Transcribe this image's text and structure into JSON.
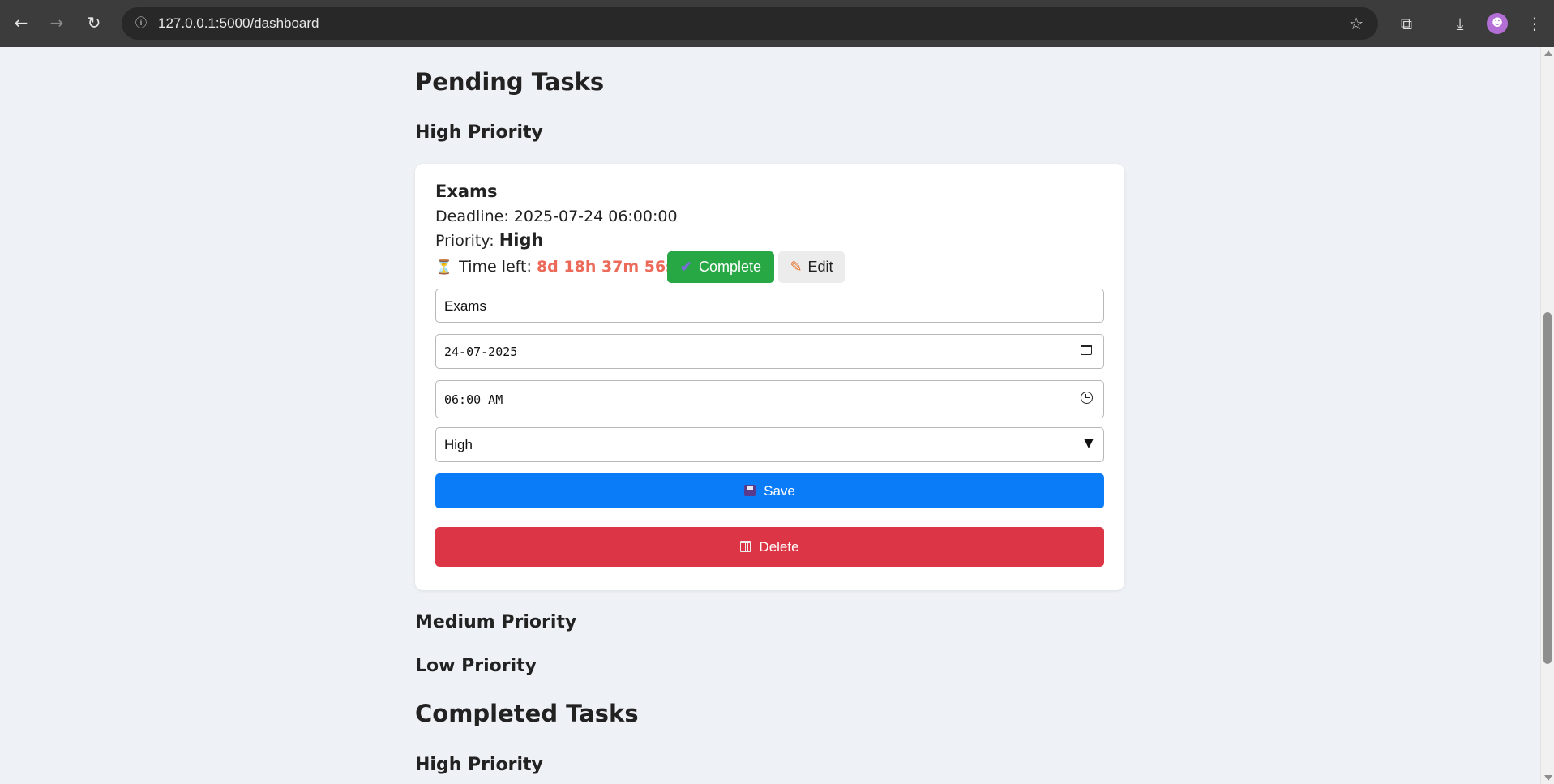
{
  "browser": {
    "url": "127.0.0.1:5000/dashboard",
    "back_icon": "←",
    "forward_icon": "→",
    "reload_icon": "↻",
    "info_icon": "ⓘ",
    "star_icon": "☆",
    "extensions_icon": "⧉",
    "download_icon": "⤓",
    "avatar_text": "☻",
    "menu_icon": "⋮"
  },
  "page": {
    "pending_heading": "Pending Tasks",
    "completed_heading": "Completed Tasks",
    "sections": {
      "high": "High Priority",
      "medium": "Medium Priority",
      "low": "Low Priority",
      "completed_high": "High Priority"
    }
  },
  "task": {
    "title": "Exams",
    "deadline_label": "Deadline:",
    "deadline_value": "2025-07-24 06:00:00",
    "priority_label": "Priority:",
    "priority_value": "High",
    "time_left_label": "Time left:",
    "time_left_value": "8d 18h 37m 56s",
    "hourglass_icon": "⏳",
    "complete_check": "✔",
    "complete_label": "Complete",
    "edit_pencil": "✎",
    "edit_label": "Edit"
  },
  "edit_form": {
    "title_value": "Exams",
    "date_value": "24-07-2025",
    "time_value": "06:00 AM",
    "priority_selected": "High",
    "save_label": "Save",
    "delete_label": "Delete"
  },
  "colors": {
    "complete_button": "#28a745",
    "save_button": "#0a7cf7",
    "delete_button": "#dc3545",
    "time_left_text": "#ec6a5a"
  }
}
